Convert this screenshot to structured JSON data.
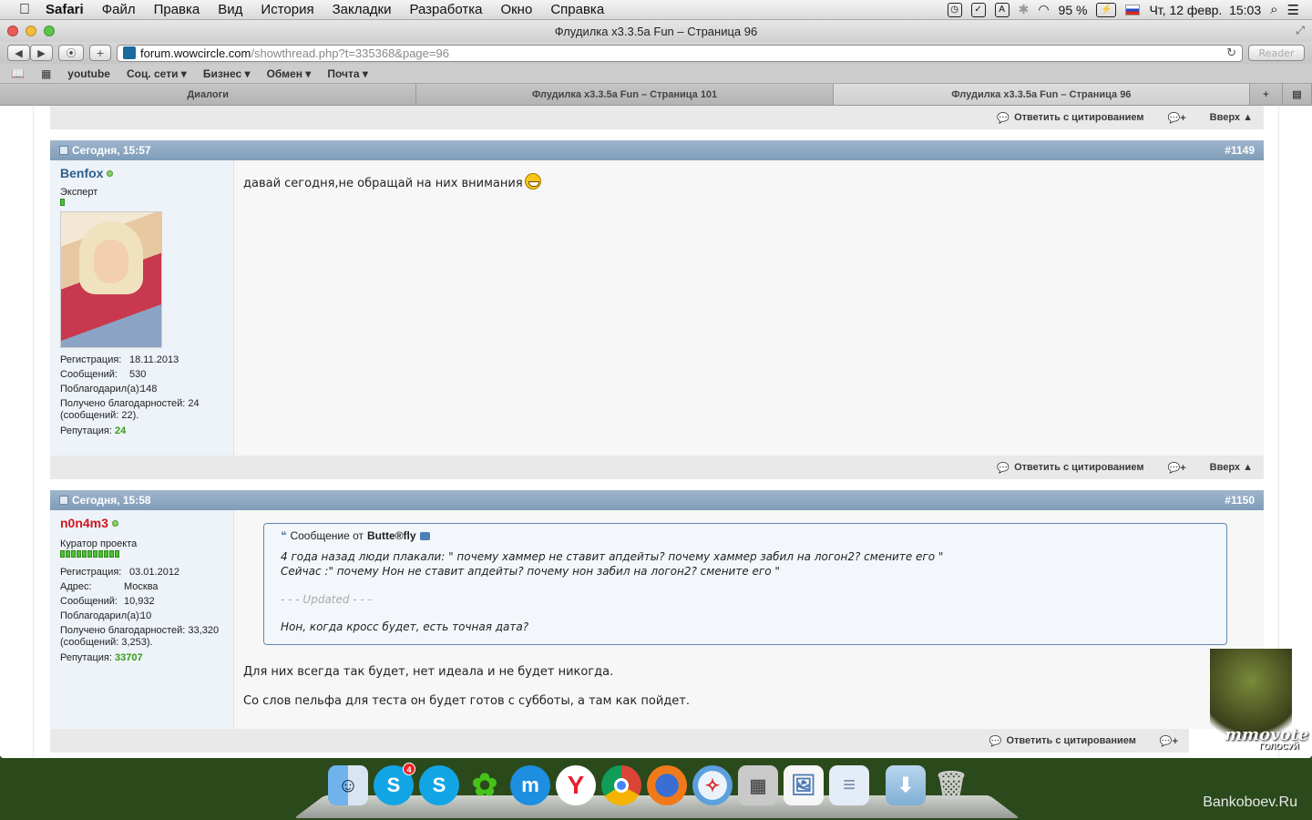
{
  "menubar": {
    "app": "Safari",
    "items": [
      "Файл",
      "Правка",
      "Вид",
      "История",
      "Закладки",
      "Разработка",
      "Окно",
      "Справка"
    ],
    "battery": "95 %",
    "datetime": "Чт, 12 февр.  15:03"
  },
  "window": {
    "title": "Флудилка x3.3.5a Fun – Страница 96"
  },
  "toolbar": {
    "url_host": "forum.wowcircle.com",
    "url_path": "/showthread.php?t=335368&page=96",
    "reader_label": "Reader"
  },
  "bookmarks": [
    "youtube",
    "Соц. сети ▾",
    "Бизнес ▾",
    "Обмен ▾",
    "Почта ▾"
  ],
  "tabs": [
    "Диалоги",
    "Флудилка x3.3.5a Fun – Страница 101",
    "Флудилка x3.3.5a Fun – Страница 96"
  ],
  "post_actions": {
    "reply_quote": "Ответить с цитированием",
    "top": "Вверх ▲"
  },
  "posts": [
    {
      "date": "Сегодня, 15:57",
      "number": "#1149",
      "user": {
        "name": "Benfox",
        "name_color": "#2d5e8e",
        "title": "Эксперт",
        "rep_bars": 1,
        "stats": [
          {
            "k": "Регистрация:",
            "v": "18.11.2013"
          },
          {
            "k": "Сообщений:",
            "v": "530"
          },
          {
            "k": "Поблагодарил(а):",
            "v": "148"
          }
        ],
        "thanks_line1": "Получено благодарностей: 24",
        "thanks_line2": "(сообщений: 22).",
        "rep_label": "Репутация:",
        "rep_value": "24"
      },
      "message": "давай сегодня,не обращай на них внимания"
    },
    {
      "date": "Сегодня, 15:58",
      "number": "#1150",
      "user": {
        "name": "n0n4m3",
        "name_color": "#d0161e",
        "title": "Куратор проекта",
        "rep_bars": 11,
        "stats": [
          {
            "k": "Регистрация:",
            "v": "03.01.2012"
          },
          {
            "k": "Адрес:",
            "v": "Москва"
          },
          {
            "k": "Сообщений:",
            "v": "10,932"
          },
          {
            "k": "Поблагодарил(а):",
            "v": "10"
          }
        ],
        "thanks_line1": "Получено благодарностей: 33,320",
        "thanks_line2": "(сообщений: 3,253).",
        "rep_label": "Репутация:",
        "rep_value": "33707"
      },
      "quote": {
        "prefix": "Сообщение от",
        "author": "Butte®fly",
        "line1": "4 года назад люди плакали: \" почему хаммер не ставит апдейты? почему хаммер забил на логон2? смените его \"",
        "line2": "Сейчас :\" почему Нон не ставит апдейты? почему нон забил на логон2? смените его \"",
        "updated": "- - - Updated - - -",
        "line3": "Нон, когда кросс будет, есть точная дата?"
      },
      "text1": "Для них всегда так будет, нет идеала и не будет никогда.",
      "text2": "Со слов пельфа для теста он будет готов с субботы, а там как пойдет."
    }
  ],
  "overlay": {
    "mmovote": "mmovote",
    "mmovote_sub": "ГОЛОСУЙ"
  },
  "dock": {
    "skype_badge": "4"
  },
  "watermark": "Bankoboev.Ru"
}
